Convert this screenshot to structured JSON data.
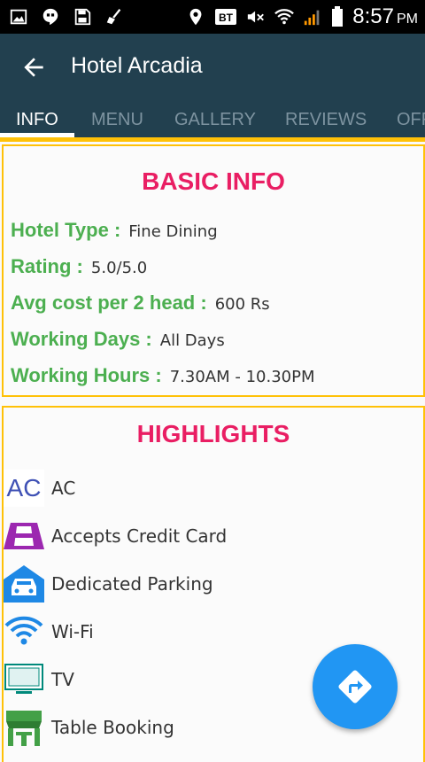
{
  "status_bar": {
    "time": "8:57",
    "ampm": "PM",
    "network_label": "BT"
  },
  "app_bar": {
    "title": "Hotel Arcadia"
  },
  "tabs": [
    {
      "label": "INFO",
      "active": true
    },
    {
      "label": "MENU",
      "active": false
    },
    {
      "label": "GALLERY",
      "active": false
    },
    {
      "label": "REVIEWS",
      "active": false
    },
    {
      "label": "OFF",
      "active": false
    }
  ],
  "basic_info": {
    "heading": "BASIC INFO",
    "rows": [
      {
        "label": "Hotel Type :",
        "value": "Fine Dining"
      },
      {
        "label": "Rating :",
        "value": "5.0/5.0"
      },
      {
        "label": "Avg cost per 2 head :",
        "value": "600 Rs"
      },
      {
        "label": "Working Days :",
        "value": "All Days"
      },
      {
        "label": "Working Hours :",
        "value": "7.30AM - 10.30PM"
      }
    ]
  },
  "highlights": {
    "heading": "HIGHLIGHTS",
    "ac_icon_text": "AC",
    "items": [
      {
        "label": "AC",
        "icon": "ac-icon"
      },
      {
        "label": "Accepts Credit Card",
        "icon": "credit-card-icon"
      },
      {
        "label": "Dedicated Parking",
        "icon": "car-icon"
      },
      {
        "label": "Wi-Fi",
        "icon": "wifi-icon"
      },
      {
        "label": "TV",
        "icon": "tv-icon"
      },
      {
        "label": "Table Booking",
        "icon": "store-icon"
      }
    ]
  },
  "fab": {
    "icon": "directions-icon"
  },
  "colors": {
    "app_bar": "#22404f",
    "accent": "#ffc107",
    "heading": "#e91e63",
    "label": "#4caf50",
    "fab": "#2196f3"
  }
}
